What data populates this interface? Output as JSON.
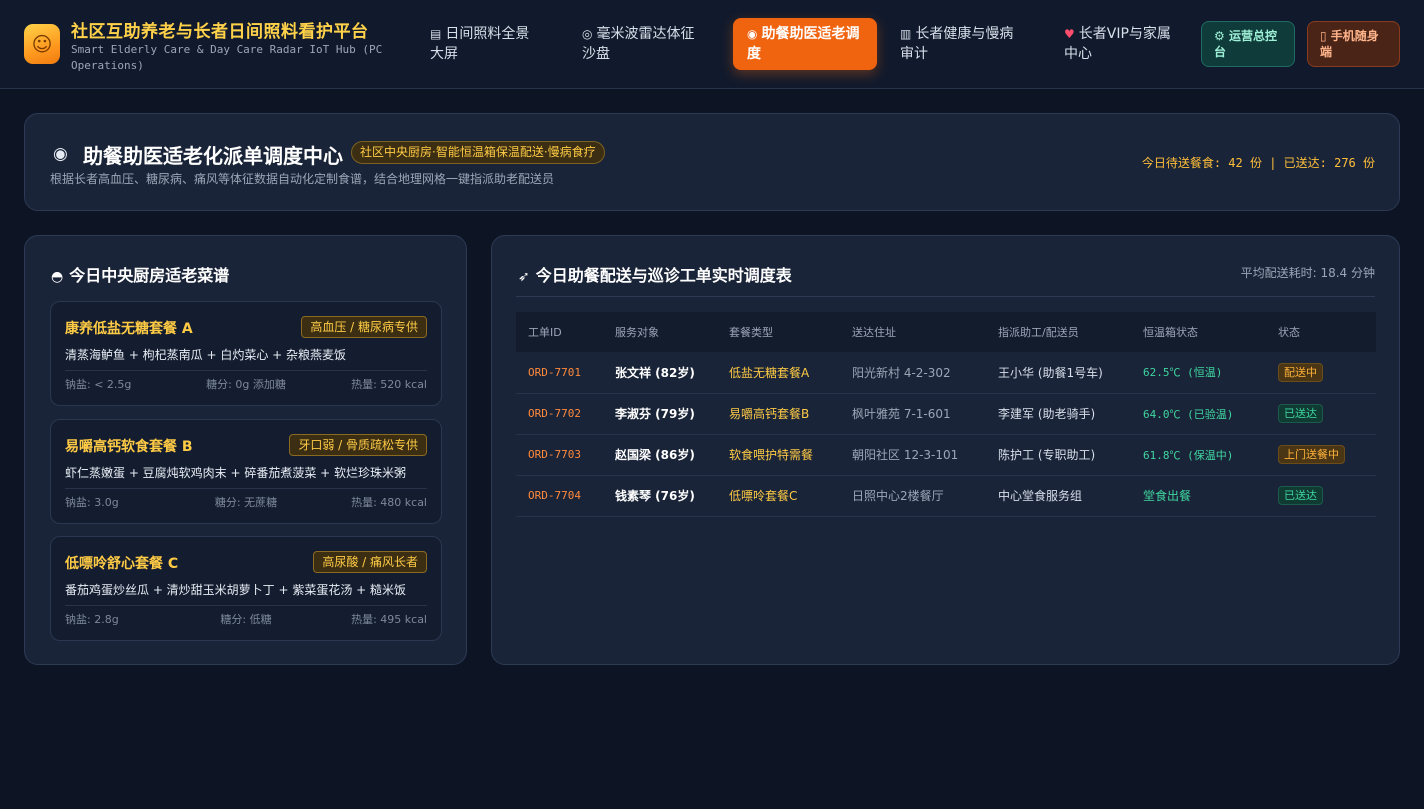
{
  "header": {
    "title": "社区互助养老与长者日间照料看护平台",
    "subtitle": "Smart Elderly Care & Day Care Radar IoT Hub (PC Operations)",
    "logo_icon": "elder-avatar-icon",
    "nav": [
      {
        "label": "日间照料全景大屏",
        "icon": "dashboard-icon"
      },
      {
        "label": "毫米波雷达体征沙盘",
        "icon": "radar-icon"
      },
      {
        "label": "助餐助医适老调度",
        "icon": "meal-icon"
      },
      {
        "label": "长者健康与慢病审计",
        "icon": "chart-icon"
      },
      {
        "label": "长者VIP与家属中心",
        "icon": "heart-icon"
      }
    ],
    "ops_button": "运营总控台",
    "mobile_button": "手机随身端"
  },
  "banner": {
    "title": "助餐助医适老化派单调度中心",
    "tag": "社区中央厨房·智能恒温箱保温配送·慢病食疗",
    "description": "根据长者高血压、糖尿病、痛风等体征数据自动化定制食谱，结合地理网格一键指派助老配送员",
    "stats": "今日待送餐食: 42 份 | 已送达: 276 份"
  },
  "menu": {
    "title": "今日中央厨房适老菜谱",
    "meals": [
      {
        "name": "康养低盐无糖套餐 A",
        "badge": "高血压 / 糖尿病专供",
        "dishes": "清蒸海鲈鱼 + 枸杞蒸南瓜 + 白灼菜心 + 杂粮燕麦饭",
        "salt": "钠盐: < 2.5g",
        "sugar": "糖分: 0g 添加糖",
        "kcal": "热量: 520 kcal"
      },
      {
        "name": "易嚼高钙软食套餐 B",
        "badge": "牙口弱 / 骨质疏松专供",
        "dishes": "虾仁蒸嫩蛋 + 豆腐炖软鸡肉末 + 碎番茄煮菠菜 + 软烂珍珠米粥",
        "salt": "钠盐: 3.0g",
        "sugar": "糖分: 无蔗糖",
        "kcal": "热量: 480 kcal"
      },
      {
        "name": "低嘌呤舒心套餐 C",
        "badge": "高尿酸 / 痛风长者",
        "dishes": "番茄鸡蛋炒丝瓜 + 清炒甜玉米胡萝卜丁 + 紫菜蛋花汤 + 糙米饭",
        "salt": "钠盐: 2.8g",
        "sugar": "糖分: 低糖",
        "kcal": "热量: 495 kcal"
      }
    ]
  },
  "orders": {
    "title": "今日助餐配送与巡诊工单实时调度表",
    "avg_time": "平均配送耗时: 18.4 分钟",
    "columns": [
      "工单ID",
      "服务对象",
      "套餐类型",
      "送达住址",
      "指派助工/配送员",
      "恒温箱状态",
      "状态"
    ],
    "rows": [
      {
        "id": "ORD-7701",
        "who": "张文祥 (82岁)",
        "pkg": "低盐无糖套餐A",
        "addr": "阳光新村 4-2-302",
        "staff": "王小华 (助餐1号车)",
        "temp": "62.5℃ (恒温)",
        "status": "配送中"
      },
      {
        "id": "ORD-7702",
        "who": "李淑芬 (79岁)",
        "pkg": "易嚼高钙套餐B",
        "addr": "枫叶雅苑 7-1-601",
        "staff": "李建军 (助老骑手)",
        "temp": "64.0℃ (已验温)",
        "status": "已送达"
      },
      {
        "id": "ORD-7703",
        "who": "赵国梁 (86岁)",
        "pkg": "软食喂护特需餐",
        "addr": "朝阳社区 12-3-101",
        "staff": "陈护工 (专职助工)",
        "temp": "61.8℃ (保温中)",
        "status": "上门送餐中"
      },
      {
        "id": "ORD-7704",
        "who": "钱素琴 (76岁)",
        "pkg": "低嘌呤套餐C",
        "addr": "日照中心2楼餐厅",
        "staff": "中心堂食服务组",
        "temp": "堂食出餐",
        "status": "已送达"
      }
    ]
  },
  "colors": {
    "accent": "#f0630f",
    "gold": "#ffcb45",
    "success": "#3fd6a0",
    "background": "#0d1424"
  }
}
